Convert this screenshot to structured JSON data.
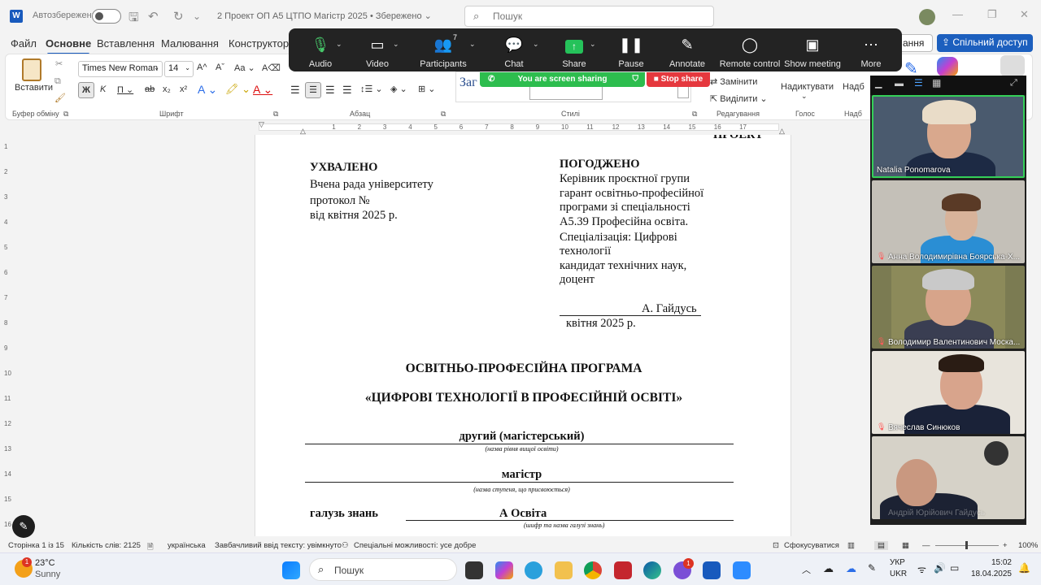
{
  "titlebar": {
    "autosave_label": "Автозбереження",
    "doc_title": "2 Проект ОП А5 ЦТПО Магістр 2025 • Збережено ⌄",
    "search_placeholder": "Пошук"
  },
  "menu": [
    "Файл",
    "Основне",
    "Вставлення",
    "Малювання",
    "Конструктор"
  ],
  "ribbon": {
    "paste": "Вставити",
    "clipboard_group": "Буфер обміну",
    "font_name": "Times New Roman",
    "font_size": "14",
    "font_group": "Шрифт",
    "para_group": "Абзац",
    "styles_group": "Стилі",
    "styles_preview": "Заг",
    "replace": "Замінити",
    "select": "Виділити",
    "editing_group": "Редагування",
    "dictate": "Надиктувати",
    "voice_group": "Голос",
    "partial_right": "Надб",
    "share_button": "Спільний доступ",
    "partial_menu": "ання"
  },
  "zoom_toolbar": {
    "items": [
      "Audio",
      "Video",
      "Participants",
      "Chat",
      "Share",
      "Pause",
      "Annotate",
      "Remote control",
      "Show meeting",
      "More"
    ],
    "participants_count": "7",
    "sharing_banner": "You are screen sharing",
    "stop_share": "Stop share"
  },
  "document": {
    "top_cut": "ПРОЕКТ",
    "left_heading": "УХВАЛЕНО",
    "left_lines": [
      "Вчена рада університету",
      "протокол №",
      "від   квітня 2025 р."
    ],
    "right_heading": "ПОГОДЖЕНО",
    "right_lines": [
      "Керівник проєктної групи",
      "гарант освітньо-професійної",
      "програми зі спеціальності",
      "А5.39 Професійна освіта.",
      "Спеціалізація: Цифрові",
      "технології",
      "кандидат технічних наук,",
      "доцент"
    ],
    "signature": "А. Гайдусь",
    "sign_date": "квітня  2025 р.",
    "program_title": "ОСВІТНЬО-ПРОФЕСІЙНА ПРОГРАМА",
    "program_name": "«ЦИФРОВІ ТЕХНОЛОГІЇ В ПРОФЕСІЙНІЙ ОСВІТІ»",
    "level": "другий (магістерський)",
    "level_note": "(назва рівня вищої освіти)",
    "degree": "магістр",
    "degree_note": "(назва ступеня, що присвоюється)",
    "field_label": "галузь знань",
    "field_value": "А Освіта",
    "field_note": "(шифр та назва галузі знань)"
  },
  "ruler_numbers": [
    "1",
    "2",
    "3",
    "4",
    "5",
    "6",
    "7",
    "8",
    "9",
    "10",
    "11",
    "12",
    "13",
    "14",
    "15",
    "16",
    "17"
  ],
  "vruler_numbers": [
    "1",
    "2",
    "3",
    "4",
    "5",
    "6",
    "7",
    "8",
    "9",
    "10",
    "11",
    "12",
    "13",
    "14",
    "15",
    "16"
  ],
  "statusbar": {
    "page": "Сторінка 1 із 15",
    "words": "Кількість слів: 2125",
    "language": "українська",
    "predictive": "Завбачливий ввід тексту: увімкнуто",
    "accessibility": "Спеціальні можливості: усе добре",
    "focus": "Сфокусуватися",
    "zoom": "100%"
  },
  "participants": [
    {
      "name": "Natalia Ponomarova",
      "muted": false
    },
    {
      "name": "Анна Володимирівна Боярська-Х...",
      "muted": true
    },
    {
      "name": "Володимир Валентинович Моска...",
      "muted": true
    },
    {
      "name": "Вячеслав Синюков",
      "muted": true
    },
    {
      "name": "Андрій Юрійович Гайдусь",
      "muted": false
    }
  ],
  "taskbar": {
    "weather_temp": "23°C",
    "weather_desc": "Sunny",
    "weather_badge": "1",
    "search_placeholder": "Пошук",
    "lang_top": "УКР",
    "lang_bottom": "UKR",
    "time": "15:02",
    "date": "18.04.2025",
    "badge_viber": "1"
  },
  "colors": {
    "accent": "#185abd",
    "zoom_bar": "#232323",
    "share_green": "#2dbd4e",
    "stop_red": "#e5383e",
    "active_speaker": "#34d058"
  }
}
